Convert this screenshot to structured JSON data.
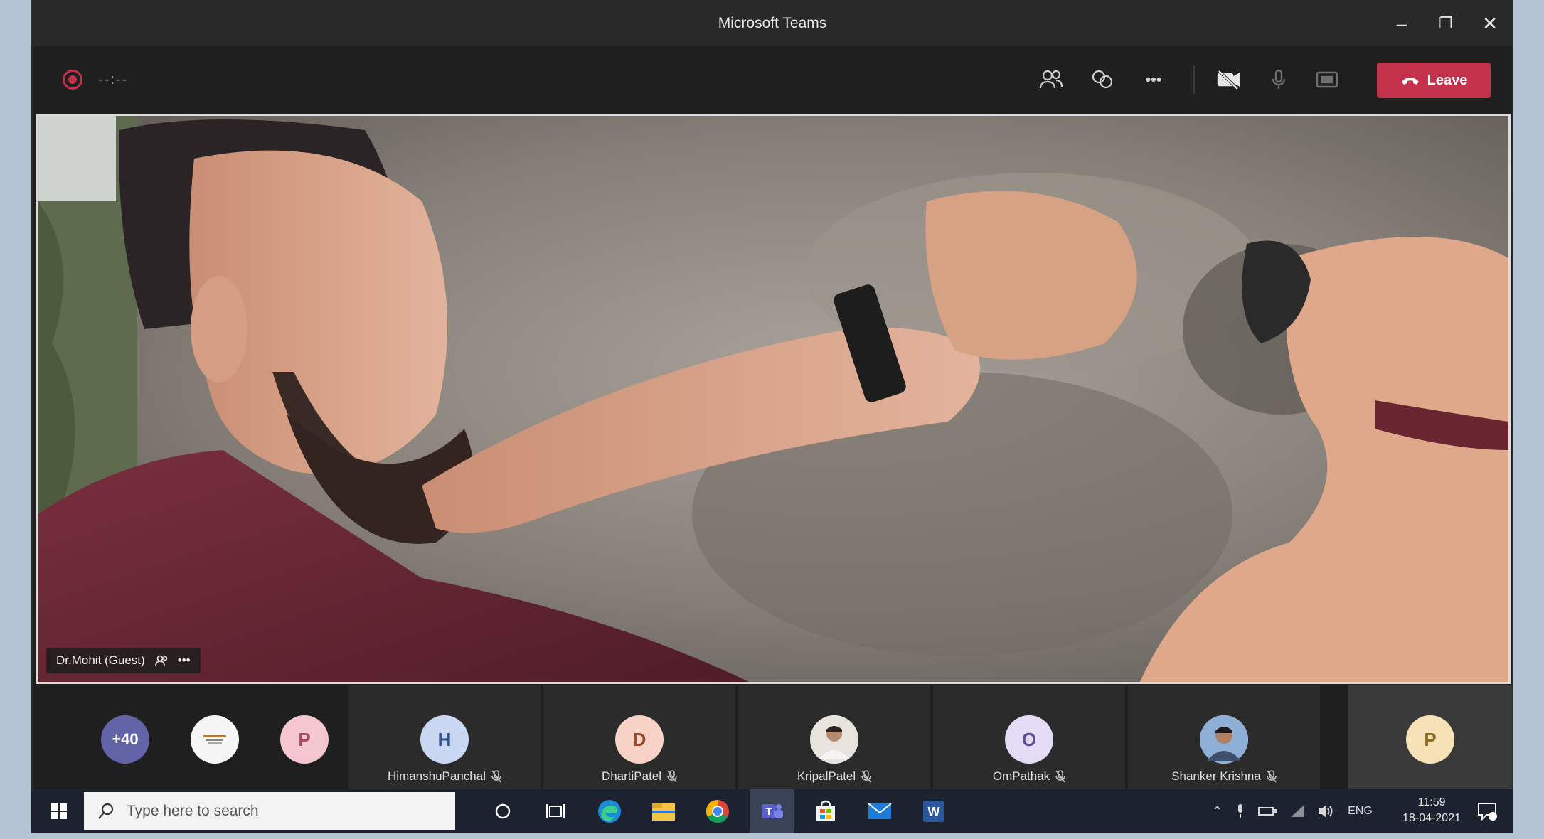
{
  "window": {
    "title": "Microsoft Teams",
    "controls": {
      "minimize": "–",
      "maximize": "❐",
      "close": "✕"
    }
  },
  "callbar": {
    "timer": "--:--",
    "icons": [
      "people-icon",
      "chat-icon",
      "more-icon",
      "camera-off-icon",
      "mic-icon",
      "share-tray-icon"
    ],
    "more_label": "•••",
    "leave_label": "Leave",
    "leave_color": "#c4314b"
  },
  "main_video": {
    "presenter_name": "Dr.Mohit (Guest)",
    "more_label": "•••"
  },
  "participants": {
    "overflow_count": "+40",
    "tiles": [
      {
        "initial": "P",
        "color": "#f4c6cf",
        "text_color": "#a64a5d"
      },
      {
        "name": "HimanshuPanchal",
        "initial": "H",
        "color": "#c9d7f2",
        "text_color": "#34568f"
      },
      {
        "name": "DhartiPatel",
        "initial": "D",
        "color": "#f6d3c6",
        "text_color": "#9a4b2d"
      },
      {
        "name": "KripalPatel",
        "initial": ""
      },
      {
        "name": "OmPathak",
        "initial": "O",
        "color": "#e2dcf5",
        "text_color": "#5b4f92"
      },
      {
        "name": "Shanker Krishna",
        "initial": ""
      },
      {
        "initial": "P",
        "color": "#f7e2b8",
        "text_color": "#8a6a1f"
      }
    ],
    "overflow_color": "#6264a7"
  },
  "taskbar": {
    "search_placeholder": "Type here to search",
    "language": "ENG",
    "time": "11:59",
    "date": "18-04-2021"
  }
}
